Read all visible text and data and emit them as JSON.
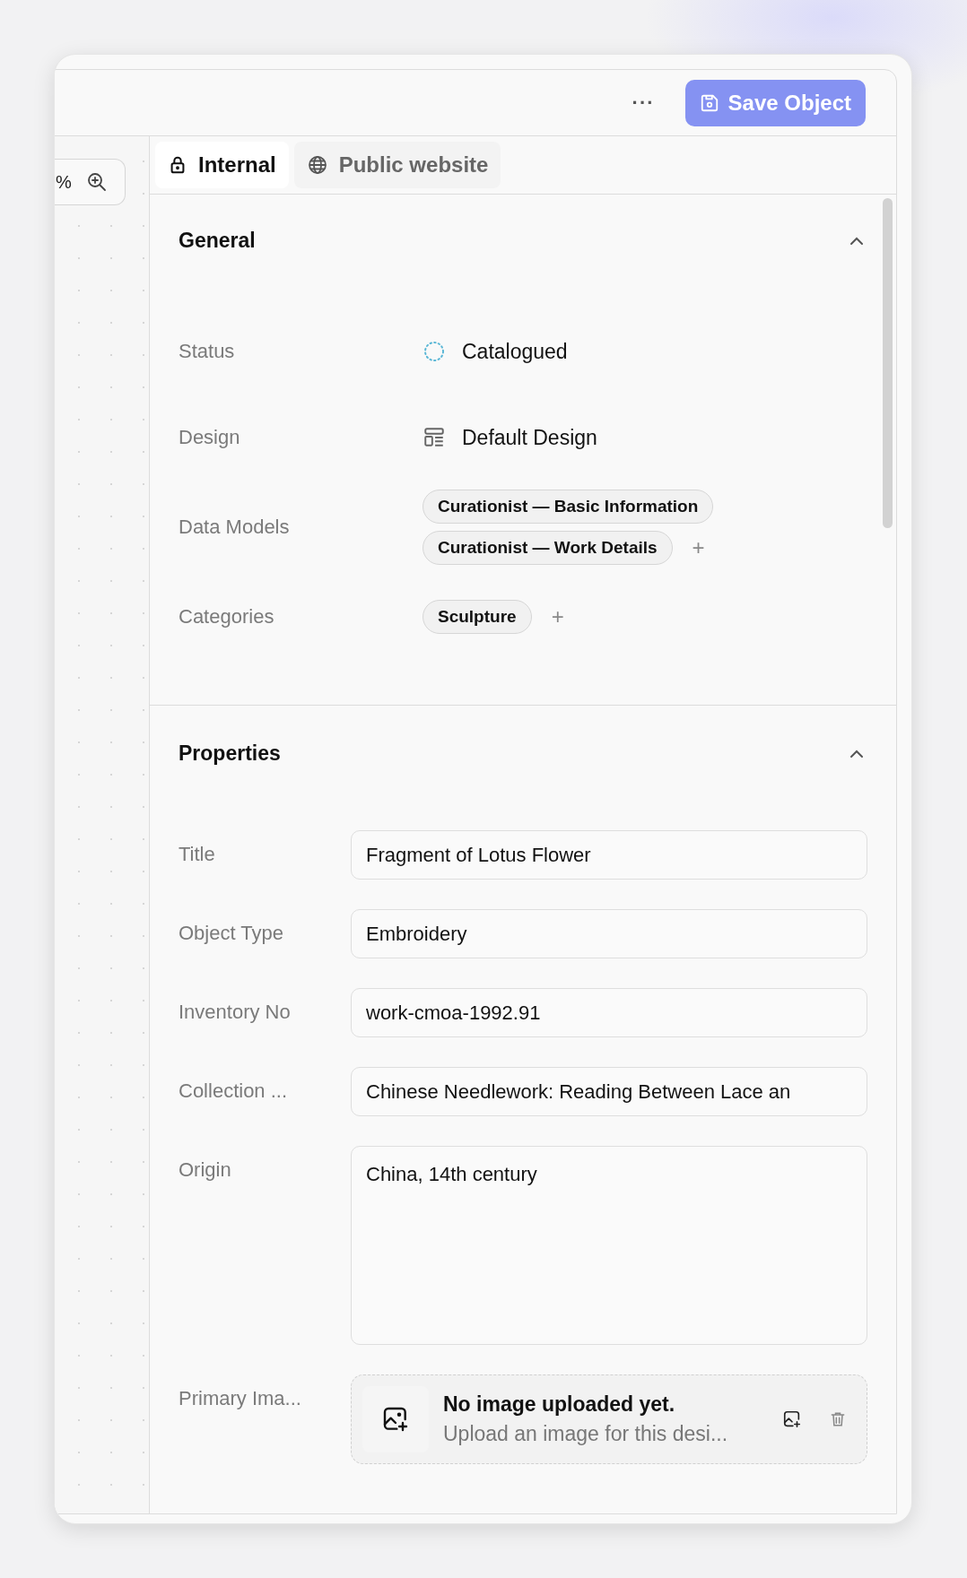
{
  "toolbar": {
    "more_label": "···",
    "save_button": "Save Object"
  },
  "canvas": {
    "zoom_text": "%"
  },
  "tabs": [
    {
      "label": "Internal",
      "kind": "private",
      "selected": true
    },
    {
      "label": "Public website",
      "kind": "public",
      "selected": false
    }
  ],
  "general": {
    "title": "General",
    "expanded": true,
    "rows": [
      {
        "kind": "status",
        "label": "Status",
        "value": "Catalogued"
      },
      {
        "kind": "design",
        "label": "Design",
        "value": "Default Design"
      },
      {
        "kind": "chips",
        "label": "Data Models",
        "chips": [
          "Curationist — Basic Information",
          "Curationist — Work Details"
        ],
        "add": "+"
      },
      {
        "kind": "chips",
        "label": "Categories",
        "chips": [
          "Sculpture"
        ],
        "add": "+"
      }
    ]
  },
  "properties": {
    "title": "Properties",
    "expanded": true,
    "fields": [
      {
        "kind": "input",
        "label": "Title",
        "value": "Fragment of Lotus Flower"
      },
      {
        "kind": "input",
        "label": "Object Type",
        "value": "Embroidery"
      },
      {
        "kind": "input",
        "label": "Inventory No",
        "value": "work-cmoa-1992.91"
      },
      {
        "kind": "input",
        "label": "Collection ...",
        "value": "Chinese Needlework: Reading Between Lace an"
      },
      {
        "kind": "textarea",
        "label": "Origin",
        "value": "China, 14th century"
      },
      {
        "kind": "image",
        "label": "Primary Ima...",
        "heading": "No image uploaded yet.",
        "hint": "Upload an image for this desi..."
      }
    ]
  }
}
